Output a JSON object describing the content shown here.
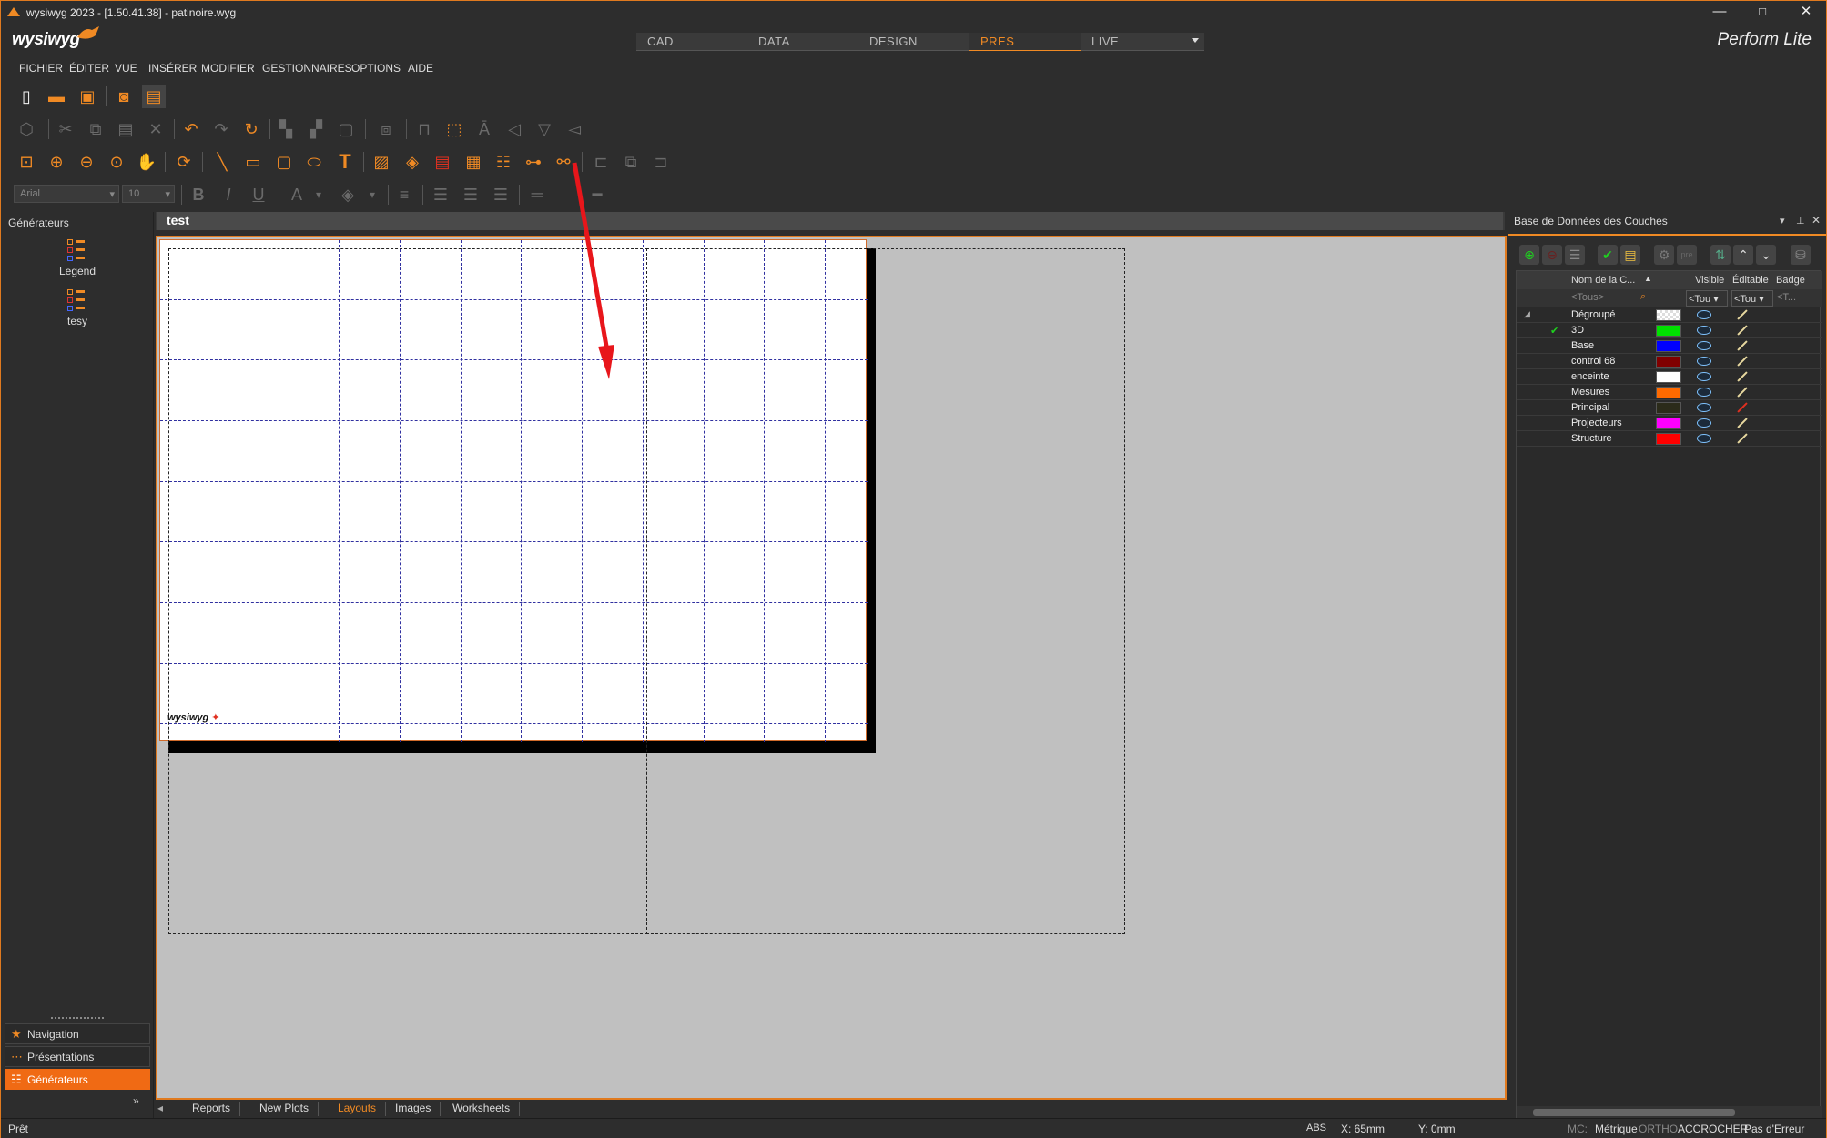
{
  "window": {
    "title": "wysiwyg 2023 - [1.50.41.38] - patinoire.wyg",
    "controls": [
      "—",
      "□",
      "✕"
    ]
  },
  "header": {
    "logo": "wysiwyg",
    "modes": [
      {
        "label": "CAD",
        "active": false
      },
      {
        "label": "DATA",
        "active": false
      },
      {
        "label": "DESIGN",
        "active": false
      },
      {
        "label": "PRES",
        "active": true
      },
      {
        "label": "LIVE",
        "active": false
      }
    ],
    "edition": "Perform Lite"
  },
  "menu": [
    "FICHIER",
    "ÉDITER",
    "VUE",
    "INSÉRER",
    "MODIFIER",
    "GESTIONNAIRES",
    "OPTIONS",
    "AIDE"
  ],
  "format_toolbar": {
    "font_name": "Arial",
    "font_size": "10"
  },
  "left_panel": {
    "title": "Générateurs",
    "generators": [
      "Legend",
      "tesy"
    ],
    "nav_buttons": [
      {
        "label": "Navigation",
        "icon": "star-icon",
        "active": false
      },
      {
        "label": "Présentations",
        "icon": "grid-icon",
        "active": false
      },
      {
        "label": "Générateurs",
        "icon": "generator-icon",
        "active": true
      }
    ]
  },
  "document": {
    "tab_title": "test",
    "paper_logo": "wysiwyg",
    "bottom_tabs": [
      {
        "label": "Reports",
        "active": false
      },
      {
        "label": "New Plots",
        "active": false
      },
      {
        "label": "Layouts",
        "active": true
      },
      {
        "label": "Images",
        "active": false
      },
      {
        "label": "Worksheets",
        "active": false
      }
    ]
  },
  "right_panel": {
    "title": "Base de Données des Couches",
    "columns": {
      "name": "Nom de la C...",
      "visible": "Visible",
      "editable": "Éditable",
      "badge": "Badge"
    },
    "filters": {
      "name": "<Tous>",
      "visible": "<Tou",
      "editable": "<Tou",
      "badge": "<T..."
    },
    "layers": [
      {
        "name": "Dégroupé",
        "color": "checker",
        "current": false,
        "group": true,
        "locked": false
      },
      {
        "name": "3D",
        "color": "#00e000",
        "current": true,
        "group": false,
        "locked": false
      },
      {
        "name": "Base",
        "color": "#0000ff",
        "current": false,
        "group": false,
        "locked": false
      },
      {
        "name": "control 68",
        "color": "#800000",
        "current": false,
        "group": false,
        "locked": false
      },
      {
        "name": "enceinte",
        "color": "#ffffff",
        "current": false,
        "group": false,
        "locked": false
      },
      {
        "name": "Mesures",
        "color": "#ff6a00",
        "current": false,
        "group": false,
        "locked": false
      },
      {
        "name": "Principal",
        "color": "#2b2b1a",
        "current": false,
        "group": false,
        "locked": true
      },
      {
        "name": "Projecteurs",
        "color": "#ff00ff",
        "current": false,
        "group": false,
        "locked": false
      },
      {
        "name": "Structure",
        "color": "#ff0000",
        "current": false,
        "group": false,
        "locked": false
      }
    ]
  },
  "status_bar": {
    "state": "Prêt",
    "abs": "ABS",
    "x": "X: 65mm",
    "y": "Y: 0mm",
    "mc": "MC:",
    "unit": "Métrique",
    "ortho": "ORTHO",
    "snap": "ACCROCHER",
    "errors": "Pas d'Erreur"
  },
  "colors": {
    "accent": "#f08a24",
    "background": "#2d2d2d",
    "canvas": "#c0c0c0",
    "grid": "#3030a0",
    "annotation_arrow": "#e8161b"
  }
}
